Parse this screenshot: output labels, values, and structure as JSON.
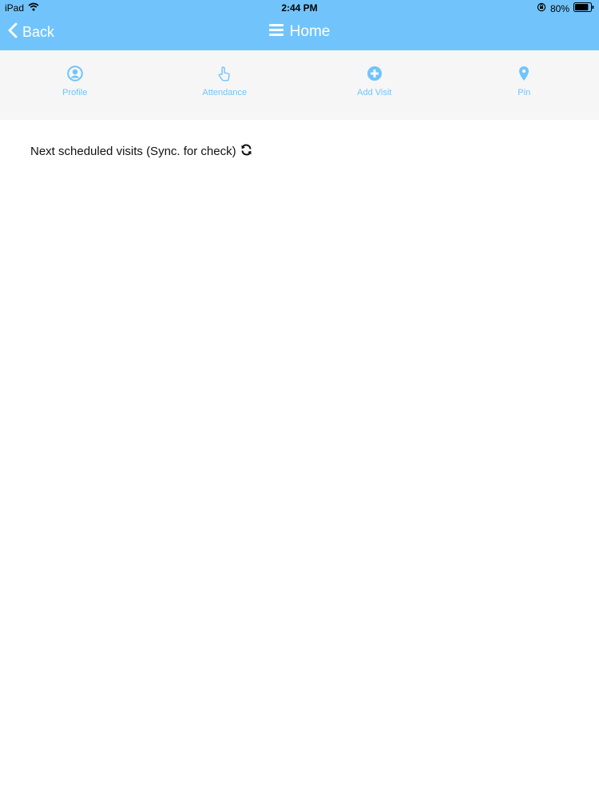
{
  "status_bar": {
    "device": "iPad",
    "time": "2:44 PM",
    "battery": "80%"
  },
  "nav_bar": {
    "back_label": "Back",
    "title": "Home"
  },
  "toolbar": {
    "items": [
      {
        "label": "Profile",
        "icon": "user-circle-icon"
      },
      {
        "label": "Attendance",
        "icon": "hand-pointer-icon"
      },
      {
        "label": "Add Visit",
        "icon": "plus-circle-icon"
      },
      {
        "label": "Pin",
        "icon": "map-pin-icon"
      }
    ]
  },
  "content": {
    "heading": "Next scheduled visits (Sync. for check)"
  },
  "colors": {
    "accent": "#71c4fb",
    "toolbar_bg": "#f6f6f7",
    "text": "#111111"
  }
}
